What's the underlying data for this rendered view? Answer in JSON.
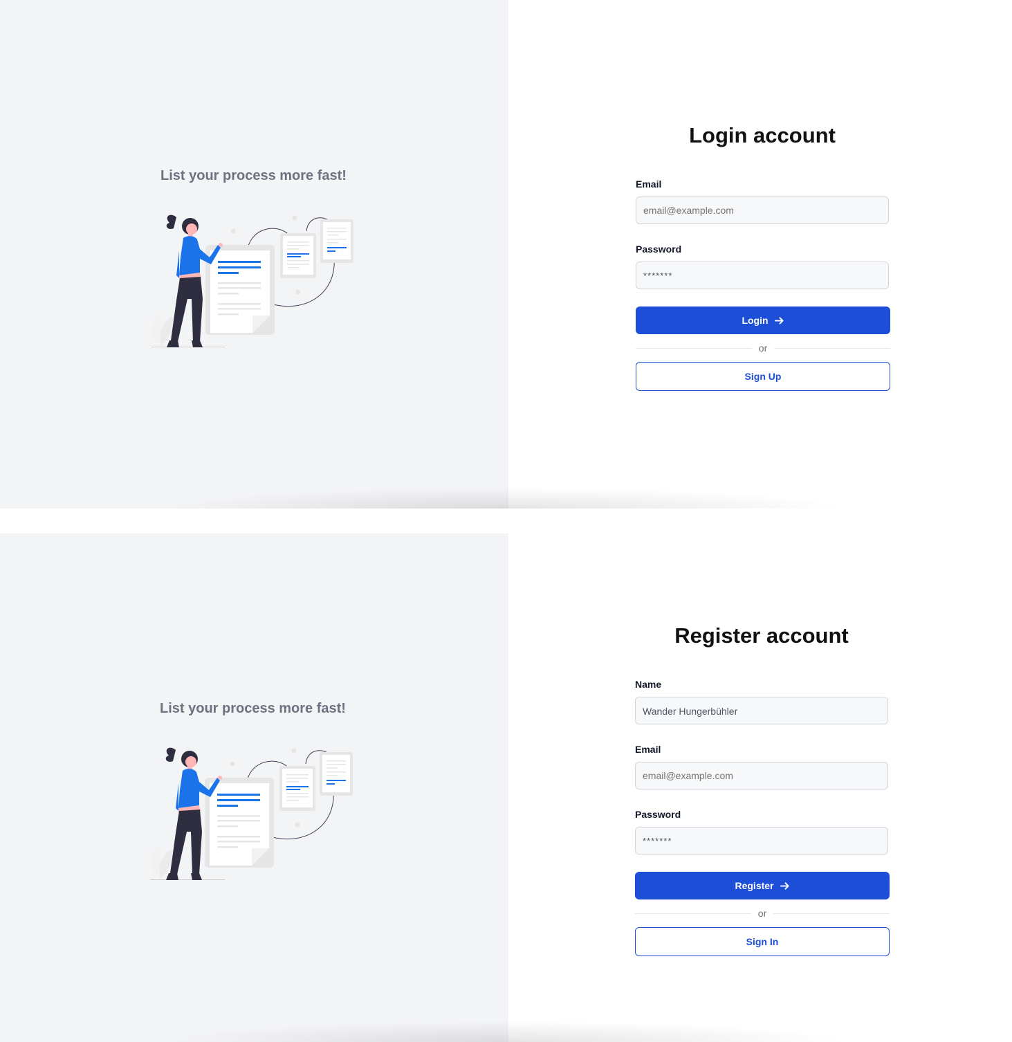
{
  "colors": {
    "primary": "#1d4ed8",
    "left_panel_bg": "#f3f4f6",
    "tagline": "#6b7280",
    "illustration_accent": "#1a73e8",
    "figure_dark": "#2f2e41"
  },
  "login": {
    "tagline": "List your process more fast!",
    "title": "Login account",
    "email_label": "Email",
    "email_placeholder": "email@example.com",
    "password_label": "Password",
    "password_value": "*******",
    "submit_label": "Login",
    "submit_icon": "arrow-right-icon",
    "divider_text": "or",
    "secondary_label": "Sign Up"
  },
  "register": {
    "tagline": "List your process more fast!",
    "title": "Register account",
    "name_label": "Name",
    "name_value": "Wander Hungerbühler",
    "email_label": "Email",
    "email_placeholder": "email@example.com",
    "password_label": "Password",
    "password_value": "*******",
    "submit_label": "Register",
    "submit_icon": "arrow-right-icon",
    "divider_text": "or",
    "secondary_label": "Sign In"
  }
}
